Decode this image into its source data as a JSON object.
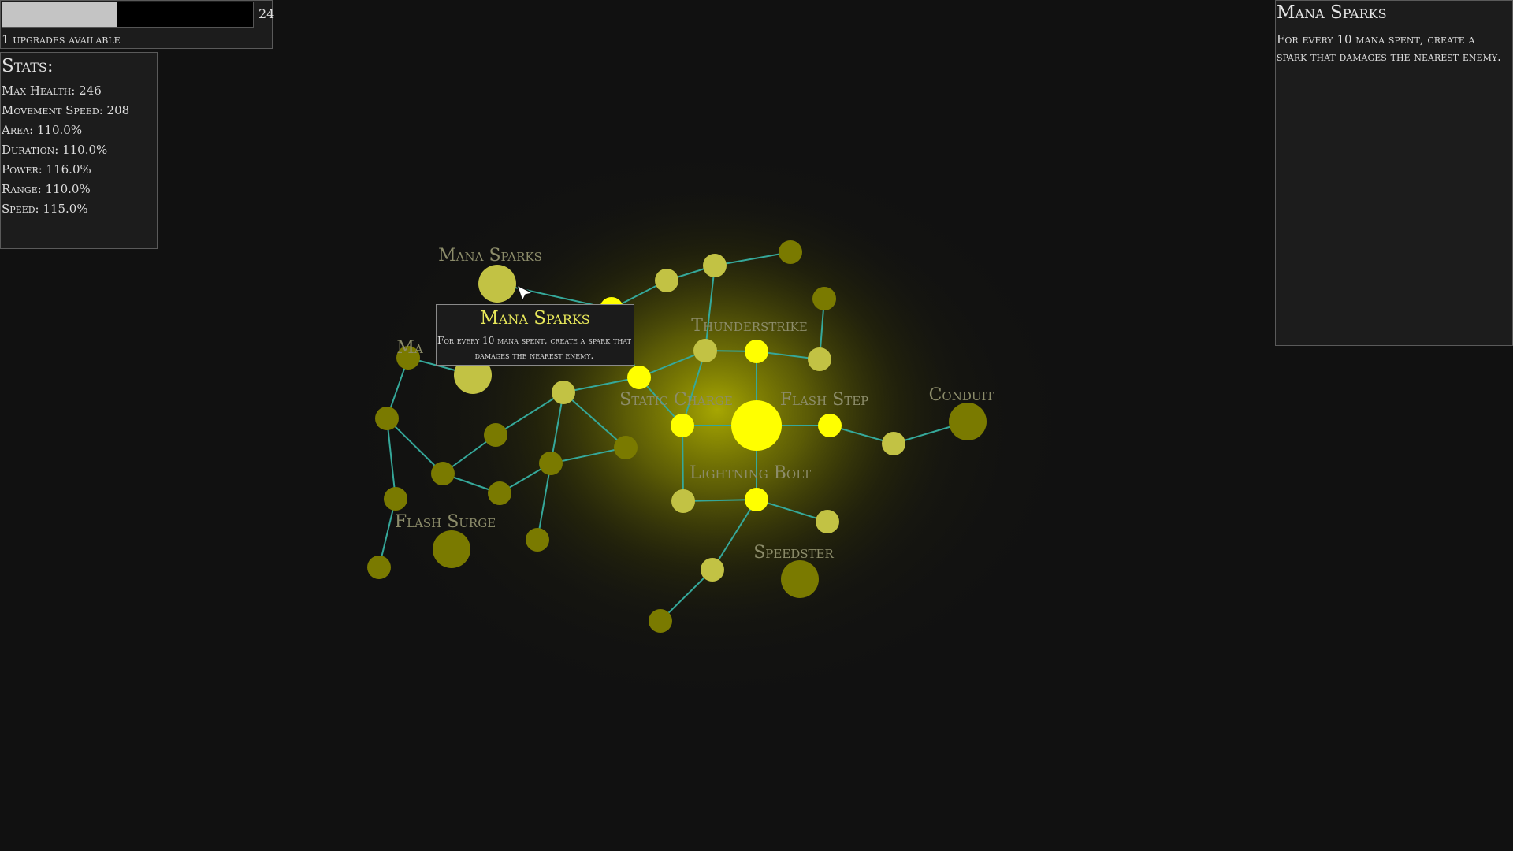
{
  "xp": {
    "progress": 0.46,
    "level": "24",
    "upgrades_label": "1 upgrades available"
  },
  "stats": {
    "title": "Stats:",
    "items": [
      "Max Health: 246",
      "Movement Speed: 208",
      "Area: 110.0%",
      "Duration: 110.0%",
      "Power: 116.0%",
      "Range: 110.0%",
      "Speed: 115.0%"
    ]
  },
  "detail": {
    "title": "Mana Sparks",
    "description": "For every 10 mana spent, create a spark that damages the nearest enemy."
  },
  "tooltip": {
    "title": "Mana Sparks",
    "description": "For every 10 mana spent, create a spark that damages the nearest enemy."
  },
  "skill_tree": {
    "colors": {
      "unlocked": "#ffff00",
      "available": "#c2c244",
      "locked": "#7a7a00",
      "edge": "#35a89a",
      "label": "#8c8c6a",
      "glow": "#bcbc00"
    },
    "labels": [
      "Mana Sparks",
      "Ma",
      "Thunderstrike",
      "Static Charge",
      "Flash Step",
      "Conduit",
      "Lightning Bolt",
      "Flash Surge",
      "Speedster"
    ],
    "nodes": [
      {
        "id": "root",
        "state": "unlocked",
        "size": "large",
        "label": ""
      },
      {
        "id": "thunderstrike",
        "state": "unlocked",
        "size": "small",
        "label": "Thunderstrike"
      },
      {
        "id": "static-charge",
        "state": "unlocked",
        "size": "small",
        "label": "Static Charge"
      },
      {
        "id": "flash-step",
        "state": "unlocked",
        "size": "small",
        "label": "Flash Step"
      },
      {
        "id": "lightning-bolt",
        "state": "unlocked",
        "size": "small",
        "label": "Lightning Bolt"
      },
      {
        "id": "static-link",
        "state": "unlocked",
        "size": "small",
        "label": ""
      },
      {
        "id": "upper-branch",
        "state": "unlocked",
        "size": "small",
        "label": ""
      },
      {
        "id": "mana-sparks",
        "state": "available",
        "size": "medium",
        "label": "Mana Sparks"
      },
      {
        "id": "ma",
        "state": "available",
        "size": "medium",
        "label": "Ma"
      },
      {
        "id": "conduit",
        "state": "locked",
        "size": "medium",
        "label": "Conduit"
      },
      {
        "id": "flash-surge",
        "state": "locked",
        "size": "medium",
        "label": "Flash Surge"
      },
      {
        "id": "speedster",
        "state": "locked",
        "size": "medium",
        "label": "Speedster"
      }
    ]
  }
}
